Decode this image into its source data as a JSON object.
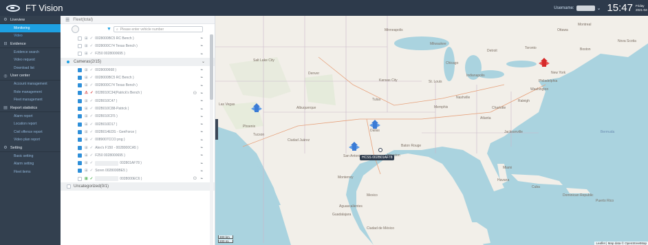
{
  "header": {
    "app_title": "FT Vision",
    "username_label": "Username:",
    "time": "15:47",
    "day": "Friday",
    "date": "2021-04-3"
  },
  "sidebar": {
    "sections": [
      {
        "icon": "gear-icon",
        "label": "Liveview",
        "items": [
          {
            "label": "Monitoring",
            "active": true
          },
          {
            "label": "Video",
            "active": false
          }
        ]
      },
      {
        "icon": "evidence-icon",
        "label": "Evidence",
        "items": [
          {
            "label": "Evidence search"
          },
          {
            "label": "Video request"
          },
          {
            "label": "Download list"
          }
        ]
      },
      {
        "icon": "user-icon",
        "label": "User center",
        "items": [
          {
            "label": "Account management"
          },
          {
            "label": "Role management"
          },
          {
            "label": "Fleet management"
          }
        ]
      },
      {
        "icon": "report-icon",
        "label": "Report statistics",
        "items": [
          {
            "label": "Alarm report"
          },
          {
            "label": "Location report"
          },
          {
            "label": "Civil offence report"
          },
          {
            "label": "Video plan report"
          }
        ]
      },
      {
        "icon": "setting-icon",
        "label": "Setting",
        "items": [
          {
            "label": "Basic setting"
          },
          {
            "label": "Alarm setting"
          },
          {
            "label": "Fleet items"
          }
        ]
      }
    ]
  },
  "panel": {
    "header": "Fleet(total)",
    "search_placeholder": "Please enter vehicle number",
    "pre_rows": [
      {
        "name": "0028000BC5 RC Bench )",
        "checked": false
      },
      {
        "name": "0028000C74 Texas Bench )",
        "checked": false
      },
      {
        "name": "F250 0028000695 )",
        "checked": false
      }
    ],
    "group_cameras": "Cameras(2/15)",
    "rows": [
      {
        "name": "0028000668 )",
        "checked": true,
        "glyph": "normal"
      },
      {
        "name": "0028000BC5 RC Bench )",
        "checked": true,
        "glyph": "normal"
      },
      {
        "name": "0028000C74 Texas Bench )",
        "checked": true,
        "glyph": "normal"
      },
      {
        "name": "0028010C34(Patrick's Bench )",
        "checked": true,
        "glyph": "alert",
        "extra": true
      },
      {
        "name": "002B010C47 )",
        "checked": true,
        "glyph": "normal"
      },
      {
        "name": "002B010C88-Patrick )",
        "checked": true,
        "glyph": "normal"
      },
      {
        "name": "002B010CF5 )",
        "checked": true,
        "glyph": "normal"
      },
      {
        "name": "002B010D17 )",
        "checked": true,
        "glyph": "normal"
      },
      {
        "name": "002B014EDS - GenForce )",
        "checked": true,
        "glyph": "normal"
      },
      {
        "name": "0089007CCO png )",
        "checked": true,
        "glyph": "normal"
      },
      {
        "name": "Alex's F150 - 0028000CA5 )",
        "checked": true,
        "glyph": "normal"
      },
      {
        "name": "F250 0028000695 )",
        "checked": true,
        "glyph": "normal"
      },
      {
        "name": "002801AF78 )",
        "checked": true,
        "glyph": "normal",
        "redacted": true
      },
      {
        "name": "Soren 0028000BE5 )",
        "checked": true,
        "glyph": "normal"
      },
      {
        "name": "0028000EC6 )",
        "checked": false,
        "glyph": "green",
        "redacted": true,
        "extra": true
      }
    ],
    "group_uncategorized": "Uncategorized(0/1)"
  },
  "map": {
    "tooltip": "HCSS 002B01AF78",
    "scale_km": "300 km",
    "scale_mi": "200 mi",
    "attribution": "Leaflet | Map data © OpenStreetMap",
    "labels": [
      {
        "text": "Minneapolis"
      },
      {
        "text": "Milwaukee"
      },
      {
        "text": "Detroit"
      },
      {
        "text": "Toronto"
      },
      {
        "text": "Chicago"
      },
      {
        "text": "Ottawa"
      },
      {
        "text": "Montreal"
      },
      {
        "text": "Boston"
      },
      {
        "text": "New York"
      },
      {
        "text": "Philadelphia"
      },
      {
        "text": "Washington"
      },
      {
        "text": "Denver"
      },
      {
        "text": "Salt Lake City"
      },
      {
        "text": "Kansas City"
      },
      {
        "text": "St. Louis"
      },
      {
        "text": "Indianapolis"
      },
      {
        "text": "Tulsa"
      },
      {
        "text": "Memphis"
      },
      {
        "text": "Nashville"
      },
      {
        "text": "Charlotte"
      },
      {
        "text": "Raleigh"
      },
      {
        "text": "Atlanta"
      },
      {
        "text": "Las Vegas"
      },
      {
        "text": "Albuquerque"
      },
      {
        "text": "Phoenix"
      },
      {
        "text": "Tucson"
      },
      {
        "text": "Dallas"
      },
      {
        "text": "Ciudad Juárez"
      },
      {
        "text": "Houston"
      },
      {
        "text": "San Antonio"
      },
      {
        "text": "Baton Rouge"
      },
      {
        "text": "Jacksonville"
      },
      {
        "text": "Monterrey"
      },
      {
        "text": "Mexico"
      },
      {
        "text": "Miami"
      },
      {
        "text": "Havana"
      },
      {
        "text": "Bermuda"
      },
      {
        "text": "Guadalajara"
      },
      {
        "text": "Aguascalientes"
      },
      {
        "text": "Ciudad de México"
      },
      {
        "text": "Cuba"
      },
      {
        "text": "Puerto Rico"
      },
      {
        "text": "Dominican Republic"
      },
      {
        "text": "Nova Scotia"
      }
    ]
  },
  "colors": {
    "topbar": "#2d3a4b",
    "sidebar": "#33404f",
    "accent": "#1ea1e3",
    "marker_blue": "#3a7bd5",
    "marker_red": "#d62a2a"
  }
}
